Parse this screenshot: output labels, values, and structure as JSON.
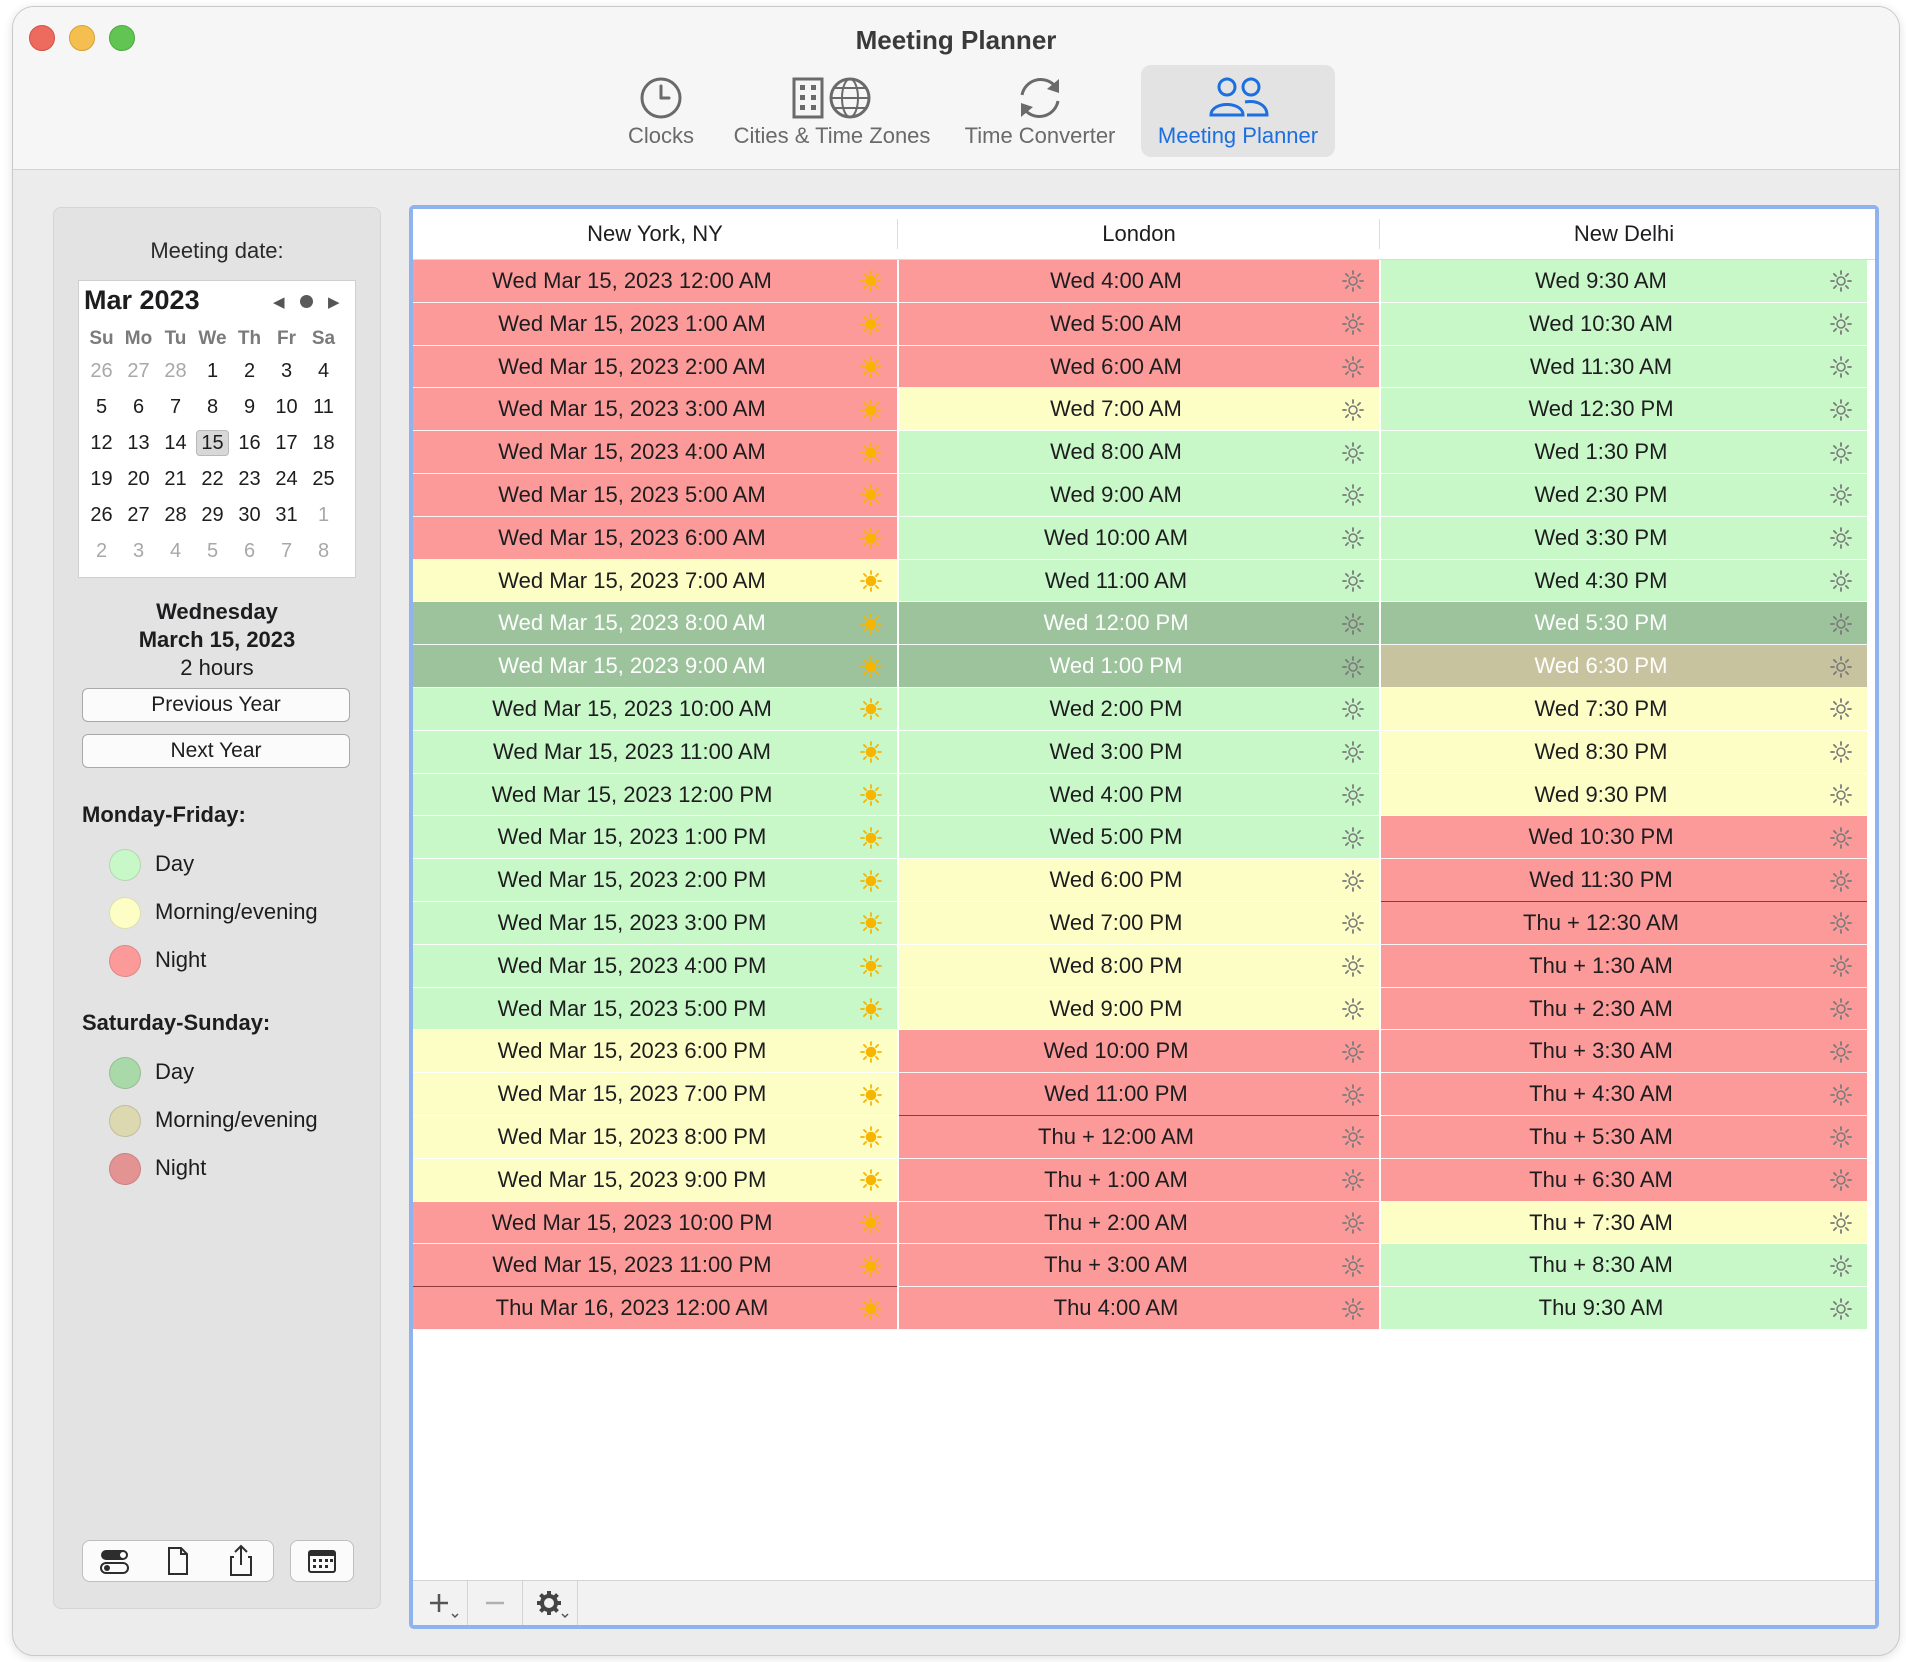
{
  "window": {
    "title": "Meeting Planner"
  },
  "toolbar": {
    "tabs": [
      {
        "label": "Clocks",
        "icon": "clock-icon",
        "active": false
      },
      {
        "label": "Cities & Time Zones",
        "icon": "building-globe-icon",
        "active": false
      },
      {
        "label": "Time Converter",
        "icon": "convert-arrows-icon",
        "active": false
      },
      {
        "label": "Meeting Planner",
        "icon": "people-icon",
        "active": true
      }
    ]
  },
  "sidebar": {
    "meeting_date_label": "Meeting date:",
    "calendar": {
      "month": "Mar 2023",
      "weekdays": [
        "Su",
        "Mo",
        "Tu",
        "We",
        "Th",
        "Fr",
        "Sa"
      ],
      "weeks": [
        [
          "26",
          "27",
          "28",
          "1",
          "2",
          "3",
          "4"
        ],
        [
          "5",
          "6",
          "7",
          "8",
          "9",
          "10",
          "11"
        ],
        [
          "12",
          "13",
          "14",
          "15",
          "16",
          "17",
          "18"
        ],
        [
          "19",
          "20",
          "21",
          "22",
          "23",
          "24",
          "25"
        ],
        [
          "26",
          "27",
          "28",
          "29",
          "30",
          "31",
          "1"
        ],
        [
          "2",
          "3",
          "4",
          "5",
          "6",
          "7",
          "8"
        ]
      ],
      "selected": "15"
    },
    "selected_weekday": "Wednesday",
    "selected_date": "March 15, 2023",
    "duration": "2 hours",
    "previous_year_label": "Previous Year",
    "next_year_label": "Next Year",
    "weekday_legend": {
      "title": "Monday-Friday:",
      "items": [
        {
          "label": "Day",
          "color": "#c8f7c8"
        },
        {
          "label": "Morning/evening",
          "color": "#fdfdc6"
        },
        {
          "label": "Night",
          "color": "#fc9a9a"
        }
      ]
    },
    "weekend_legend": {
      "title": "Saturday-Sunday:",
      "items": [
        {
          "label": "Day",
          "color": "#a9d9a9"
        },
        {
          "label": "Morning/evening",
          "color": "#dcd8b0"
        },
        {
          "label": "Night",
          "color": "#e49393"
        }
      ]
    }
  },
  "table": {
    "columns": [
      "New York, NY",
      "London",
      "New Delhi"
    ],
    "colors": {
      "day": "#c8f7c8",
      "mid": "#fdfdc6",
      "night": "#fc9a9a",
      "sel": "#9cc39c",
      "selmid": "#c8c39f",
      "line": "#8c3a3a"
    },
    "rows": [
      [
        [
          "Wed Mar 15, 2023 12:00 AM",
          "night"
        ],
        [
          "Wed 4:00 AM",
          "night"
        ],
        [
          "Wed 9:30 AM",
          "day"
        ]
      ],
      [
        [
          "Wed Mar 15, 2023 1:00 AM",
          "night"
        ],
        [
          "Wed 5:00 AM",
          "night"
        ],
        [
          "Wed 10:30 AM",
          "day"
        ]
      ],
      [
        [
          "Wed Mar 15, 2023 2:00 AM",
          "night"
        ],
        [
          "Wed 6:00 AM",
          "night"
        ],
        [
          "Wed 11:30 AM",
          "day"
        ]
      ],
      [
        [
          "Wed Mar 15, 2023 3:00 AM",
          "night"
        ],
        [
          "Wed 7:00 AM",
          "mid"
        ],
        [
          "Wed 12:30 PM",
          "day"
        ]
      ],
      [
        [
          "Wed Mar 15, 2023 4:00 AM",
          "night"
        ],
        [
          "Wed 8:00 AM",
          "day"
        ],
        [
          "Wed 1:30 PM",
          "day"
        ]
      ],
      [
        [
          "Wed Mar 15, 2023 5:00 AM",
          "night"
        ],
        [
          "Wed 9:00 AM",
          "day"
        ],
        [
          "Wed 2:30 PM",
          "day"
        ]
      ],
      [
        [
          "Wed Mar 15, 2023 6:00 AM",
          "night"
        ],
        [
          "Wed 10:00 AM",
          "day"
        ],
        [
          "Wed 3:30 PM",
          "day"
        ]
      ],
      [
        [
          "Wed Mar 15, 2023 7:00 AM",
          "mid"
        ],
        [
          "Wed 11:00 AM",
          "day"
        ],
        [
          "Wed 4:30 PM",
          "day"
        ]
      ],
      [
        [
          "Wed Mar 15, 2023 8:00 AM",
          "sel"
        ],
        [
          "Wed 12:00 PM",
          "sel"
        ],
        [
          "Wed 5:30 PM",
          "sel"
        ]
      ],
      [
        [
          "Wed Mar 15, 2023 9:00 AM",
          "sel"
        ],
        [
          "Wed 1:00 PM",
          "sel"
        ],
        [
          "Wed 6:30 PM",
          "selmid"
        ]
      ],
      [
        [
          "Wed Mar 15, 2023 10:00 AM",
          "day"
        ],
        [
          "Wed 2:00 PM",
          "day"
        ],
        [
          "Wed 7:30 PM",
          "mid"
        ]
      ],
      [
        [
          "Wed Mar 15, 2023 11:00 AM",
          "day"
        ],
        [
          "Wed 3:00 PM",
          "day"
        ],
        [
          "Wed 8:30 PM",
          "mid"
        ]
      ],
      [
        [
          "Wed Mar 15, 2023 12:00 PM",
          "day"
        ],
        [
          "Wed 4:00 PM",
          "day"
        ],
        [
          "Wed 9:30 PM",
          "mid"
        ]
      ],
      [
        [
          "Wed Mar 15, 2023 1:00 PM",
          "day"
        ],
        [
          "Wed 5:00 PM",
          "day"
        ],
        [
          "Wed 10:30 PM",
          "night"
        ]
      ],
      [
        [
          "Wed Mar 15, 2023 2:00 PM",
          "day"
        ],
        [
          "Wed 6:00 PM",
          "mid"
        ],
        [
          "Wed 11:30 PM",
          "night",
          "cut"
        ]
      ],
      [
        [
          "Wed Mar 15, 2023 3:00 PM",
          "day"
        ],
        [
          "Wed 7:00 PM",
          "mid"
        ],
        [
          "Thu + 12:30 AM",
          "night"
        ]
      ],
      [
        [
          "Wed Mar 15, 2023 4:00 PM",
          "day"
        ],
        [
          "Wed 8:00 PM",
          "mid"
        ],
        [
          "Thu + 1:30 AM",
          "night"
        ]
      ],
      [
        [
          "Wed Mar 15, 2023 5:00 PM",
          "day"
        ],
        [
          "Wed 9:00 PM",
          "mid"
        ],
        [
          "Thu + 2:30 AM",
          "night"
        ]
      ],
      [
        [
          "Wed Mar 15, 2023 6:00 PM",
          "mid"
        ],
        [
          "Wed 10:00 PM",
          "night"
        ],
        [
          "Thu + 3:30 AM",
          "night"
        ]
      ],
      [
        [
          "Wed Mar 15, 2023 7:00 PM",
          "mid"
        ],
        [
          "Wed 11:00 PM",
          "night",
          "cut"
        ],
        [
          "Thu + 4:30 AM",
          "night"
        ]
      ],
      [
        [
          "Wed Mar 15, 2023 8:00 PM",
          "mid"
        ],
        [
          "Thu + 12:00 AM",
          "night"
        ],
        [
          "Thu + 5:30 AM",
          "night"
        ]
      ],
      [
        [
          "Wed Mar 15, 2023 9:00 PM",
          "mid"
        ],
        [
          "Thu + 1:00 AM",
          "night"
        ],
        [
          "Thu + 6:30 AM",
          "night"
        ]
      ],
      [
        [
          "Wed Mar 15, 2023 10:00 PM",
          "night"
        ],
        [
          "Thu + 2:00 AM",
          "night"
        ],
        [
          "Thu + 7:30 AM",
          "mid"
        ]
      ],
      [
        [
          "Wed Mar 15, 2023 11:00 PM",
          "night",
          "cut"
        ],
        [
          "Thu + 3:00 AM",
          "night"
        ],
        [
          "Thu + 8:30 AM",
          "day"
        ]
      ],
      [
        [
          "Thu Mar 16, 2023 12:00 AM",
          "night"
        ],
        [
          "Thu 4:00 AM",
          "night"
        ],
        [
          "Thu 9:30 AM",
          "day"
        ]
      ]
    ],
    "footer_buttons": [
      {
        "name": "add-city-button",
        "icon": "plus-icon"
      },
      {
        "name": "remove-city-button",
        "icon": "minus-icon"
      },
      {
        "name": "actions-menu-button",
        "icon": "gear-icon"
      }
    ]
  },
  "bottom_toolbar": [
    {
      "name": "toggle-view-button",
      "icon": "toggle-icon"
    },
    {
      "name": "document-button",
      "icon": "document-icon"
    },
    {
      "name": "share-button",
      "icon": "share-icon"
    },
    {
      "name": "calendar-button",
      "icon": "calendar-icon"
    }
  ]
}
